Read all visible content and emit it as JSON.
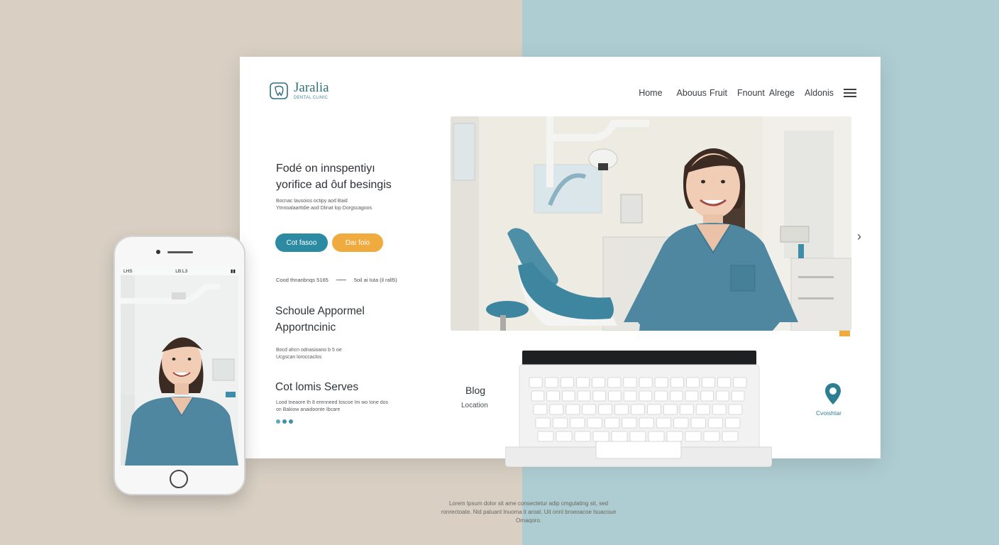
{
  "colors": {
    "left_background": "#d9d0c3",
    "right_background": "#aecdd2",
    "accent_teal": "#2c8aa2",
    "accent_orange": "#f0ab3f"
  },
  "brand": {
    "name": "Jaralia",
    "tagline": "DENTAL CLINIC"
  },
  "nav": {
    "items": [
      "Home",
      "Abouus",
      "Fruit",
      "Fnount",
      "Alrege",
      "Aldonis"
    ],
    "menu_icon": "hamburger-icon"
  },
  "hero": {
    "title_line1": "Fodé on innspentiyı",
    "title_line2": "yorifice ad ôuf besingis",
    "body": "Bocnac lausoios octipy aod Baid Ytnnoalaarttdie aod Dlinat lop Dorgscagoos"
  },
  "buttons": {
    "primary": "Cot fasoo",
    "secondary": "Daı foio"
  },
  "stats": {
    "left": "Cood thnanbnqs 5165",
    "right": "5oil ai Iuta (il rall5)"
  },
  "appointment": {
    "title_line1": "Schoule Appormel",
    "title_line2": "Apportncinic",
    "body": "Bocd ahcn odnasioano b 5 oe Ucgscan loroccaclos"
  },
  "services": {
    "title": "Cot lomis Serves",
    "body": "Lood tneaore th 8 erenneed loscoe Im wo Ione dos on Bakiow anaidoonte Ibcare"
  },
  "blog": {
    "title": "Blog",
    "location": "Location"
  },
  "map": {
    "pin_label": "Cvoishtar"
  },
  "phone": {
    "time": "LB:L3",
    "carrier": "LHS"
  },
  "caption": {
    "line1": "Lorem Ipsum dolor sit ame consectetur adip cmgulating sit, sed",
    "line2": "ronrectoate. Nid paluant lnuoma it aroat. Uit onnl broeoacoe lsuacoue",
    "line3": "Ornaqoro."
  }
}
